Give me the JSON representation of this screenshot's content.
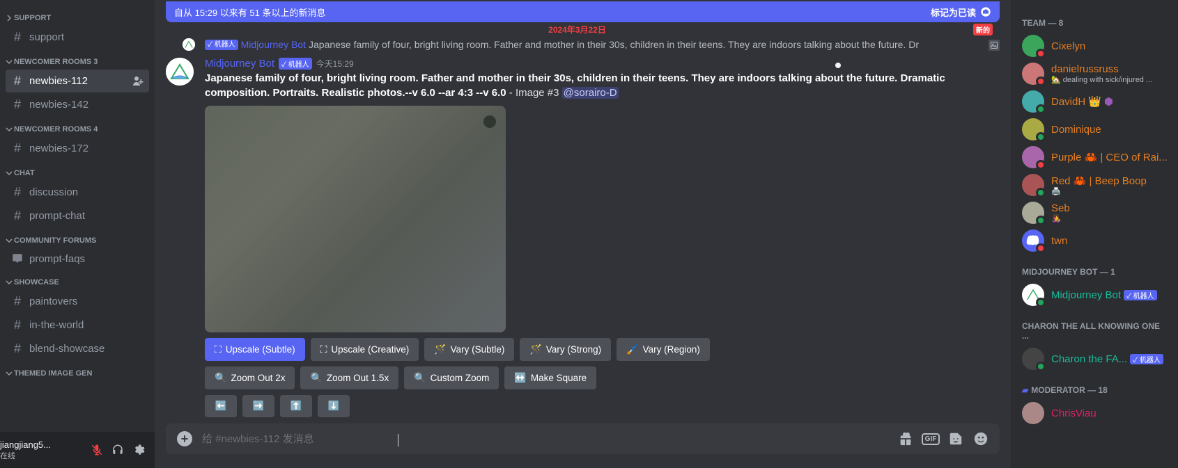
{
  "channels": {
    "support_cat": "SUPPORT",
    "support": "support",
    "newcomer3_cat": "NEWCOMER ROOMS 3",
    "newbies112": "newbies-112",
    "newbies142": "newbies-142",
    "newcomer4_cat": "NEWCOMER ROOMS 4",
    "newbies172": "newbies-172",
    "chat_cat": "CHAT",
    "discussion": "discussion",
    "prompt_chat": "prompt-chat",
    "forums_cat": "COMMUNITY FORUMS",
    "prompt_faqs": "prompt-faqs",
    "showcase_cat": "SHOWCASE",
    "paintovers": "paintovers",
    "in_the_world": "in-the-world",
    "blend_showcase": "blend-showcase",
    "themed_cat": "THEMED IMAGE GEN"
  },
  "user_panel": {
    "name": "jiangjiang5...",
    "status": "在线"
  },
  "banner": {
    "left": "自从 15:29 以来有 51 条以上的新消息",
    "right": "标记为已读"
  },
  "date_divider": "2024年3月22日",
  "date_pill": "新的",
  "msg_compact": {
    "bot_tag": "✓ 机器人",
    "author": "Midjourney Bot",
    "content": "Japanese family of four, bright living room. Father and mother in their 30s, children in their teens. They are indoors talking about the future. Dr"
  },
  "msg_full": {
    "author": "Midjourney Bot",
    "bot_tag": "✓ 机器人",
    "time": "今天15:29",
    "prompt_bold": "Japanese family of four, bright living room. Father and mother in their 30s, children in their teens. They are indoors talking about the future. Dramatic composition. Portraits. Realistic photos.--v 6.0 --ar 4:3 --v 6.0",
    "image_tag": " - Image #3 ",
    "mention": "@sorairo-D"
  },
  "buttons": {
    "upscale_subtle": "Upscale (Subtle)",
    "upscale_creative": "Upscale (Creative)",
    "vary_subtle": "Vary (Subtle)",
    "vary_strong": "Vary (Strong)",
    "vary_region": "Vary (Region)",
    "zoom2x": "Zoom Out 2x",
    "zoom15x": "Zoom Out 1.5x",
    "custom_zoom": "Custom Zoom",
    "make_square": "Make Square",
    "left": "⬅️",
    "right": "➡️",
    "up": "⬆️",
    "down": "⬇️"
  },
  "input": {
    "placeholder": "给 #newbies-112 发消息",
    "gif": "GIF"
  },
  "members": {
    "team_cat": "TEAM — 8",
    "cixelyn": "Cixelyn",
    "daniel": "danielrussruss",
    "daniel_sub": "🏡 dealing with sick/injured ...",
    "davidh": "DavidH",
    "dominique": "Dominique",
    "purple": "Purple 🦀 | CEO of Rai...",
    "red": "Red 🦀 | Beep Boop",
    "red_sub": "🖨️",
    "seb": "Seb",
    "seb_sub": "👩‍🎤",
    "twn": "twn",
    "mj_cat": "MIDJOURNEY BOT — 1",
    "mj_bot": "Midjourney Bot",
    "bot_badge": "✓ 机器人",
    "charon_cat": "CHARON THE ALL KNOWING ONE ...",
    "charon": "Charon the FA...",
    "mod_cat": "MODERATOR — 18",
    "chris": "ChrisViau"
  }
}
